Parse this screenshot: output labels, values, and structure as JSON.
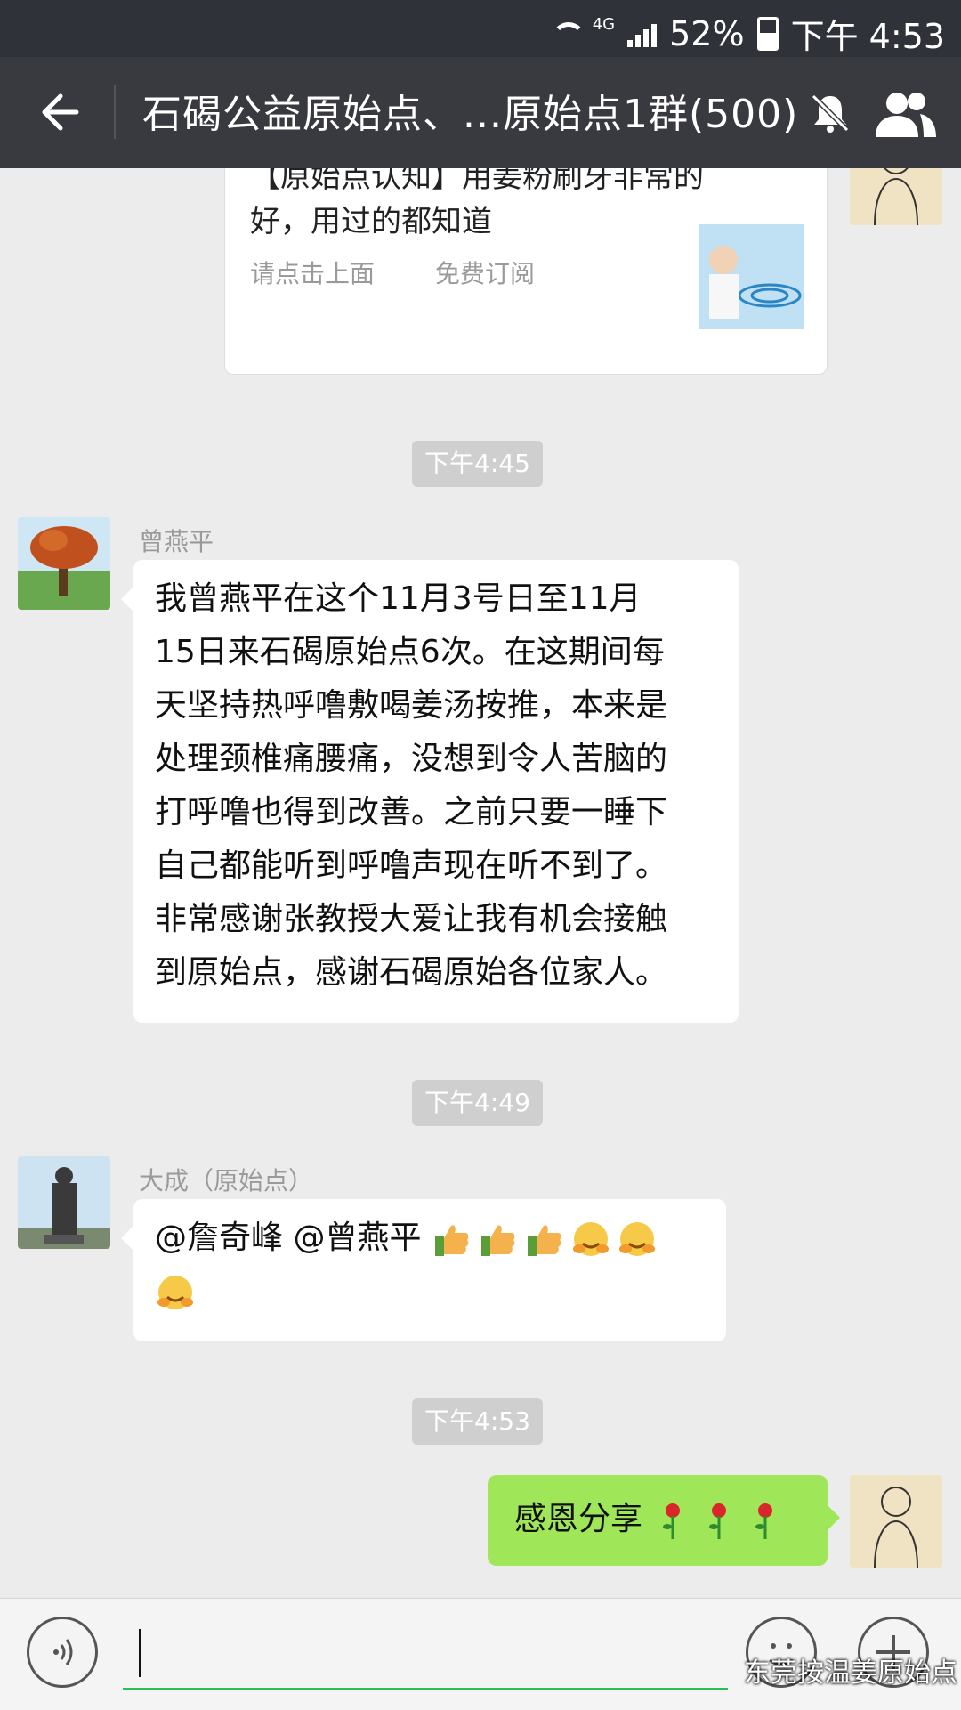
{
  "status_bar": {
    "network": "4G",
    "battery": "52%",
    "time": "下午 4:53"
  },
  "header": {
    "title": "石碣公益原始点、...原始点1群(500)"
  },
  "article_card": {
    "title_line1": "【原始点认知】用姜粉刷牙非常的",
    "title_line2": "好，用过的都知道",
    "subtitle_left": "请点击上面",
    "subtitle_right": "免费订阅"
  },
  "messages": [
    {
      "time": "下午4:45"
    },
    {
      "sender": "曾燕平",
      "lines": [
        "我曾燕平在这个11月3号日至11月",
        "15日来石碣原始点6次。在这期间每",
        "天坚持热呼噜敷喝姜汤按推，本来是",
        "处理颈椎痛腰痛，没想到令人苦脑的",
        "打呼噜也得到改善。之前只要一睡下",
        "自己都能听到呼噜声现在听不到了。",
        "非常感谢张教授大爱让我有机会接触",
        "到原始点，感谢石碣原始各位家人。"
      ]
    },
    {
      "time": "下午4:49"
    },
    {
      "sender": "大成（原始点）",
      "text": "@詹奇峰 @曾燕平 "
    },
    {
      "time": "下午4:53"
    },
    {
      "text": "感恩分享"
    }
  ],
  "watermark": "东莞按温姜原始点",
  "icons": [
    "back-arrow-icon",
    "mute-bell-icon",
    "group-members-icon",
    "voice-icon",
    "emoji-icon",
    "plus-icon",
    "thumbs-up-icon",
    "hug-emoji-icon",
    "rose-icon"
  ]
}
